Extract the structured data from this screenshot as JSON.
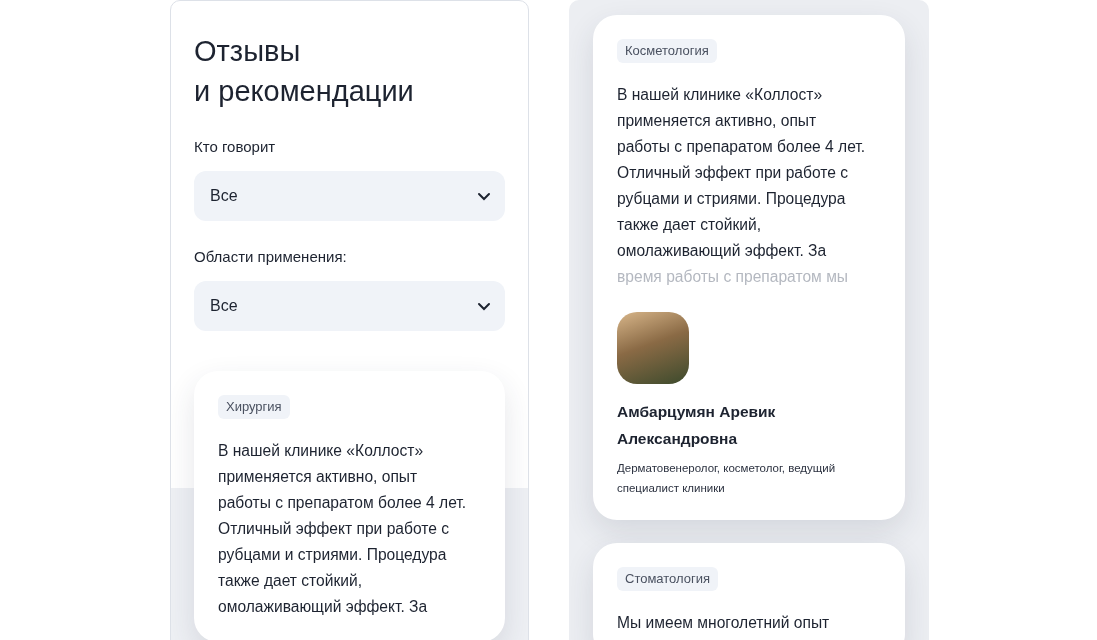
{
  "left_panel": {
    "title": [
      "Отзывы",
      "и рекомендации"
    ],
    "filters": [
      {
        "label": "Кто говорит",
        "value": "Все"
      },
      {
        "label": "Области применения:",
        "value": "Все"
      }
    ],
    "cards": [
      {
        "tag": "Хирургия",
        "text": "В нашей клинике «Коллост» применяется активно, опыт работы с препаратом более 4 лет. Отличный эффект при работе с рубцами и стриями. Процедура также дает стойкий, омолаживающий эффект. За"
      }
    ]
  },
  "right_panel": {
    "cards": [
      {
        "tag": "Косметология",
        "text": "В нашей клинике «Коллост» применяется активно, опыт работы с препаратом более 4 лет. Отличный эффект при работе с рубцами и стриями. Процедура также дает стойкий, омолаживающий эффект. За",
        "faded_text": "время работы с препаратом мы",
        "author": {
          "name": "Амбарцумян Аревик Александровна",
          "role": "Дерматовенеролог, косметолог, ведущий специалист клиники"
        }
      },
      {
        "tag": "Стоматология",
        "text": "Мы имеем многолетний опыт"
      }
    ]
  }
}
